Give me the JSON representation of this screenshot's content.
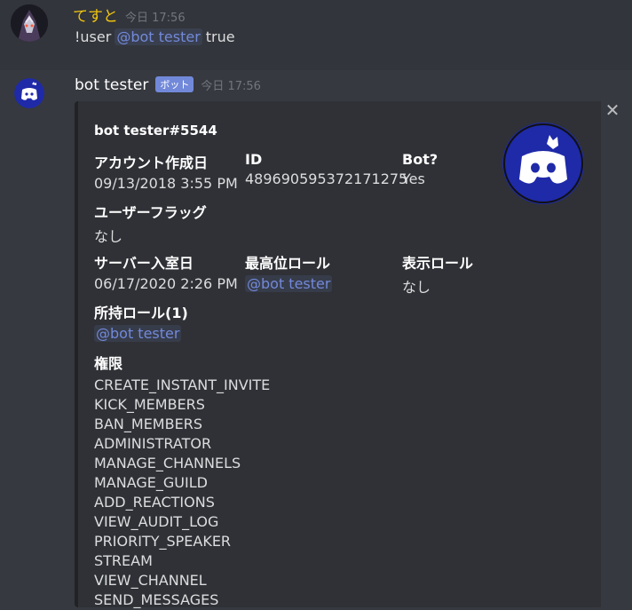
{
  "message1": {
    "username": "てすと",
    "timestamp": "今日 17:56",
    "command": "!user",
    "mention": "@bot tester",
    "arg": "true"
  },
  "message2": {
    "username": "bot tester",
    "bot_tag": "ボット",
    "timestamp": "今日 17:56"
  },
  "embed": {
    "title": "bot tester#5544",
    "fields": {
      "account_created": {
        "name": "アカウント作成日",
        "value": "09/13/2018 3:55 PM"
      },
      "id": {
        "name": "ID",
        "value": "489690595372171275"
      },
      "bot": {
        "name": "Bot?",
        "value": "Yes"
      },
      "user_flags": {
        "name": "ユーザーフラッグ",
        "value": "なし"
      },
      "joined": {
        "name": "サーバー入室日",
        "value": "06/17/2020 2:26 PM"
      },
      "highest_role": {
        "name": "最高位ロール",
        "value": "@bot tester"
      },
      "display_role": {
        "name": "表示ロール",
        "value": "なし"
      },
      "roles": {
        "name": "所持ロール(1)",
        "value": "@bot tester"
      },
      "permissions": {
        "name": "権限",
        "items": [
          "CREATE_INSTANT_INVITE",
          "KICK_MEMBERS",
          "BAN_MEMBERS",
          "ADMINISTRATOR",
          "MANAGE_CHANNELS",
          "MANAGE_GUILD",
          "ADD_REACTIONS",
          "VIEW_AUDIT_LOG",
          "PRIORITY_SPEAKER",
          "STREAM",
          "VIEW_CHANNEL",
          "SEND_MESSAGES"
        ]
      }
    }
  },
  "icons": {
    "close": "close-icon",
    "bot_avatar": "discord-logo-icon",
    "user_avatar": "user-avatar"
  },
  "colors": {
    "background": "#36393f",
    "highlight_row": "#32353b",
    "embed_bg": "#2f3136",
    "mention": "#7289da",
    "username_yellow": "#f1c40f",
    "bot_avatar_blue": "#1f2aa8"
  }
}
